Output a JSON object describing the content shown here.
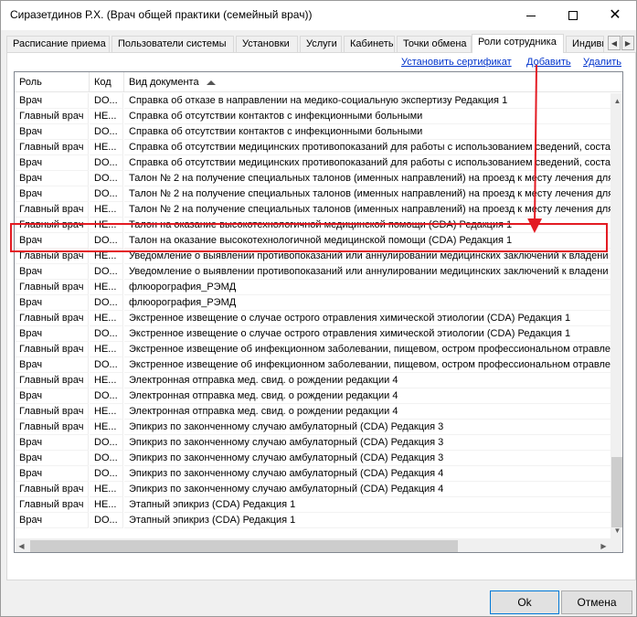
{
  "window": {
    "title": "Сиразетдинов Р.Х. (Врач общей практики (семейный врач))"
  },
  "tabs": [
    {
      "label": "Расписание приема"
    },
    {
      "label": "Пользователи системы"
    },
    {
      "label": "Установки"
    },
    {
      "label": "Услуги"
    },
    {
      "label": "Кабинеты"
    },
    {
      "label": "Точки обмена"
    },
    {
      "label": "Роли сотрудника"
    },
    {
      "label": "Индивид"
    }
  ],
  "toolbar": {
    "install_cert": "Установить сертификат",
    "add": "Добавить",
    "delete": "Удалить"
  },
  "table": {
    "headers": {
      "role": "Роль",
      "code": "Код",
      "doc": "Вид документа"
    },
    "rows": [
      {
        "role": "Врач",
        "code": "DO...",
        "doc": "Справка об отказе в направлении на медико-социальную экспертизу Редакция 1"
      },
      {
        "role": "Главный врач",
        "code": "HE...",
        "doc": "Справка об отсутствии контактов с инфекционными больными"
      },
      {
        "role": "Врач",
        "code": "DO...",
        "doc": "Справка об отсутствии контактов с инфекционными больными"
      },
      {
        "role": "Главный врач",
        "code": "HE...",
        "doc": "Справка об отсутствии медицинских противопоказаний для работы с использованием сведений, соста"
      },
      {
        "role": "Врач",
        "code": "DO...",
        "doc": "Справка об отсутствии медицинских противопоказаний для работы с использованием сведений, соста"
      },
      {
        "role": "Врач",
        "code": "DO...",
        "doc": "Талон № 2 на получение специальных талонов (именных направлений) на проезд к месту лечения для г"
      },
      {
        "role": "Врач",
        "code": "DO...",
        "doc": "Талон № 2 на получение специальных талонов (именных направлений) на проезд к месту лечения для п"
      },
      {
        "role": "Главный врач",
        "code": "HE...",
        "doc": "Талон № 2 на получение специальных талонов (именных направлений) на проезд к месту лечения для п"
      },
      {
        "role": "Главный врач",
        "code": "HE...",
        "doc": "Талон на оказание высокотехнологичной медицинской помощи (CDA) Редакция 1"
      },
      {
        "role": "Врач",
        "code": "DO...",
        "doc": "Талон на оказание высокотехнологичной медицинской помощи (CDA) Редакция 1"
      },
      {
        "role": "Главный врач",
        "code": "HE...",
        "doc": "Уведомление о выявлении противопоказаний или аннулировании медицинских заключений к владени"
      },
      {
        "role": "Врач",
        "code": "DO...",
        "doc": "Уведомление о выявлении противопоказаний или аннулировании медицинских заключений к владени"
      },
      {
        "role": "Главный врач",
        "code": "HE...",
        "doc": "флюорография_РЭМД"
      },
      {
        "role": "Врач",
        "code": "DO...",
        "doc": "флюорография_РЭМД"
      },
      {
        "role": "Главный врач",
        "code": "HE...",
        "doc": "Экстренное извещение о случае острого отравления химической этиологии (CDA) Редакция 1"
      },
      {
        "role": "Врач",
        "code": "DO...",
        "doc": "Экстренное извещение о случае острого отравления химической этиологии (CDA) Редакция 1"
      },
      {
        "role": "Главный врач",
        "code": "HE...",
        "doc": "Экстренное извещение об инфекционном заболевании, пищевом, остром профессиональном отравле"
      },
      {
        "role": "Врач",
        "code": "DO...",
        "doc": "Экстренное извещение об инфекционном заболевании, пищевом, остром профессиональном отравле"
      },
      {
        "role": "Главный врач",
        "code": "HE...",
        "doc": "Электронная отправка мед. свид. о рождении редакции 4"
      },
      {
        "role": "Врач",
        "code": "DO...",
        "doc": "Электронная отправка мед. свид. о рождении редакции 4"
      },
      {
        "role": "Главный врач",
        "code": "HE...",
        "doc": "Электронная отправка мед. свид. о рождении редакции 4"
      },
      {
        "role": "Главный врач",
        "code": "HE...",
        "doc": "Эпикриз по законченному случаю амбулаторный (CDA) Редакция 3"
      },
      {
        "role": "Врач",
        "code": "DO...",
        "doc": "Эпикриз по законченному случаю амбулаторный (CDA) Редакция 3"
      },
      {
        "role": "Врач",
        "code": "DO...",
        "doc": "Эпикриз по законченному случаю амбулаторный (CDA) Редакция 3"
      },
      {
        "role": "Врач",
        "code": "DO...",
        "doc": "Эпикриз по законченному случаю амбулаторный (CDA) Редакция 4"
      },
      {
        "role": "Главный врач",
        "code": "HE...",
        "doc": "Эпикриз по законченному случаю амбулаторный (CDA) Редакция 4"
      },
      {
        "role": "Главный врач",
        "code": "HE...",
        "doc": "Этапный эпикриз (CDA) Редакция 1"
      },
      {
        "role": "Врач",
        "code": "DO...",
        "doc": "Этапный эпикриз (CDA) Редакция 1"
      }
    ]
  },
  "buttons": {
    "ok": "Ok",
    "cancel": "Отмена"
  },
  "annotation": {
    "color": "#e31b23"
  }
}
